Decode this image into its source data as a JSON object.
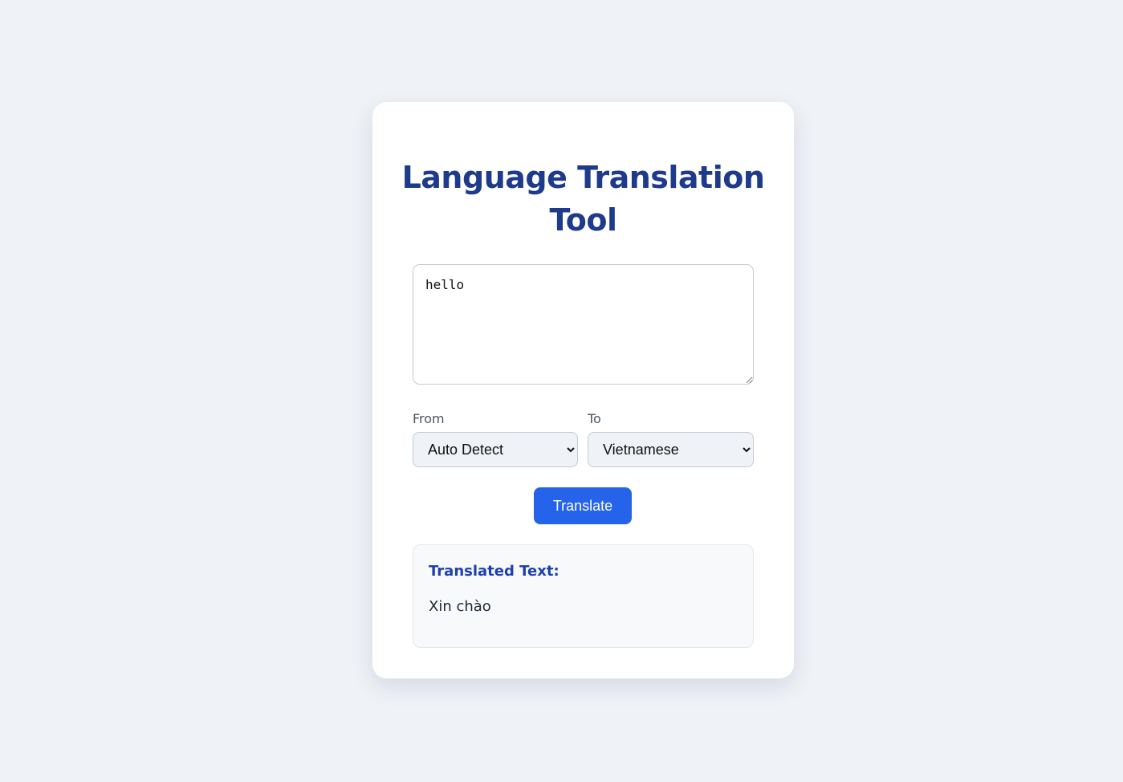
{
  "app": {
    "title": "Language Translation Tool"
  },
  "input": {
    "value": "hello",
    "placeholder": ""
  },
  "languages": {
    "from_label": "From",
    "from_selected": "Auto Detect",
    "to_label": "To",
    "to_selected": "Vietnamese"
  },
  "actions": {
    "translate_label": "Translate"
  },
  "result": {
    "heading": "Translated Text:",
    "text": "Xin chào"
  },
  "colors": {
    "page_background": "#eff2f6",
    "card_background": "#ffffff",
    "title": "#1e3a8a",
    "button": "#2563eb",
    "result_heading": "#1e40af"
  }
}
